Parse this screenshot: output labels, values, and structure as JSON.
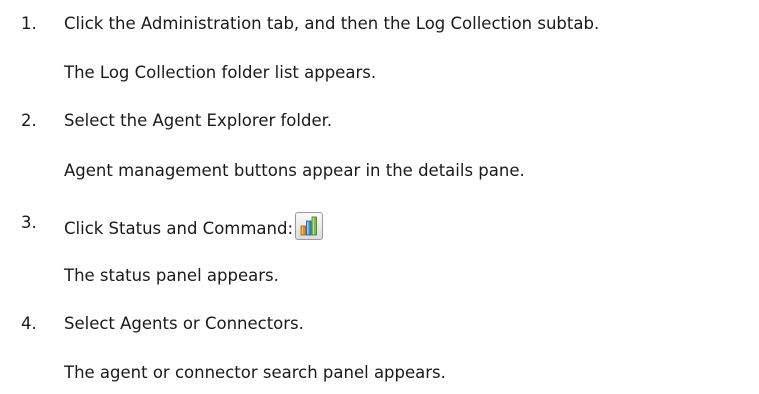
{
  "steps": [
    {
      "number": "1.",
      "action": "Click the Administration tab, and then the Log Collection subtab.",
      "result": "The Log Collection folder list appears."
    },
    {
      "number": "2.",
      "action": "Select the Agent Explorer folder.",
      "result": "Agent management buttons appear in the details pane."
    },
    {
      "number": "3.",
      "action": "Click Status and Command:",
      "icon": "status-and-command-icon",
      "result": "The status panel appears."
    },
    {
      "number": "4.",
      "action": "Select Agents or Connectors.",
      "result": "The agent or connector search panel appears."
    }
  ]
}
